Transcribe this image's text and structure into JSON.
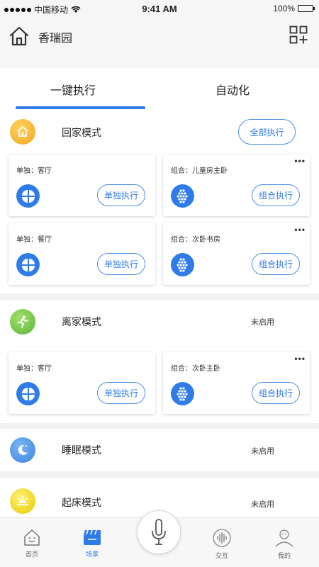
{
  "status_bar": {
    "carrier": "中国移动",
    "time": "9:41 AM",
    "battery": "100%"
  },
  "header": {
    "title": "香瑞园",
    "icons": [
      "home-icon",
      "grid-add-icon"
    ]
  },
  "tabs": [
    {
      "label": "一键执行",
      "active": true
    },
    {
      "label": "自动化",
      "active": false
    }
  ],
  "modes": [
    {
      "title": "回家模式",
      "icon": "home-icon",
      "action_label": "全部执行",
      "cards": [
        {
          "label": "单独：客厅",
          "button": "单独执行",
          "icon": "four-leaf-icon",
          "more": false
        },
        {
          "label": "组合：儿童房主卧",
          "button": "组合执行",
          "icon": "dot-grid-icon",
          "more": true
        },
        {
          "label": "单独：餐厅",
          "button": "单独执行",
          "icon": "four-leaf-icon",
          "more": false
        },
        {
          "label": "组合：次卧书房",
          "button": "组合执行",
          "icon": "dot-grid-icon",
          "more": true
        }
      ]
    },
    {
      "title": "离家模式",
      "icon": "running-person-icon",
      "status": "未启用",
      "cards": [
        {
          "label": "单独：客厅",
          "button": "单独执行",
          "icon": "four-leaf-icon",
          "more": false
        },
        {
          "label": "组合：次卧主卧",
          "button": "组合执行",
          "icon": "dot-grid-icon",
          "more": true
        }
      ]
    },
    {
      "title": "睡眠模式",
      "icon": "moon-icon",
      "status": "未启用"
    },
    {
      "title": "起床模式",
      "icon": "sunrise-icon",
      "status": "未启用"
    }
  ],
  "more_glyph": "•••",
  "tabbar": [
    {
      "label": "首页",
      "icon": "home-face-icon",
      "active": false
    },
    {
      "label": "场景",
      "icon": "clapperboard-icon",
      "active": true
    },
    {
      "label": "",
      "icon": "microphone-icon",
      "active": false
    },
    {
      "label": "交互",
      "icon": "sound-wave-icon",
      "active": false
    },
    {
      "label": "我的",
      "icon": "person-icon",
      "active": false
    }
  ],
  "colors": {
    "accent": "#2f7be8",
    "home_mode": "#f5a623",
    "away_mode": "#6cc04a",
    "sleep_mode": "#4a90e2",
    "wake_mode": "#f0d000"
  }
}
